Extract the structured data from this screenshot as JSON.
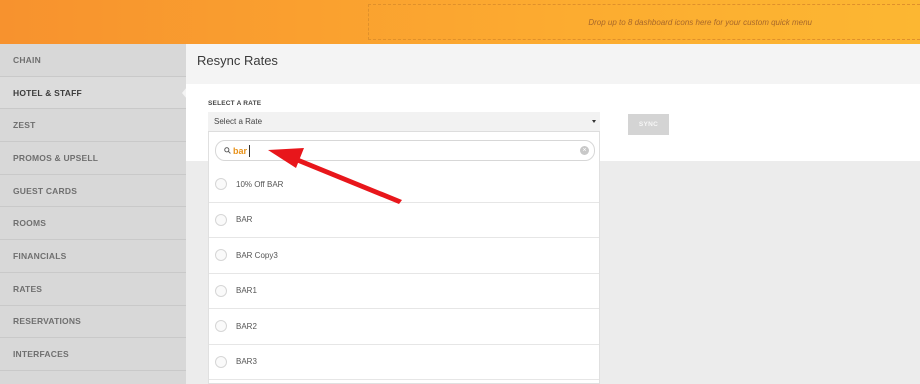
{
  "quick_menu": {
    "hint": "Drop up to 8 dashboard icons here for your custom quick menu"
  },
  "sidebar": {
    "items": [
      {
        "label": "CHAIN"
      },
      {
        "label": "HOTEL & STAFF"
      },
      {
        "label": "ZEST"
      },
      {
        "label": "PROMOS & UPSELL"
      },
      {
        "label": "GUEST CARDS"
      },
      {
        "label": "ROOMS"
      },
      {
        "label": "FINANCIALS"
      },
      {
        "label": "RATES"
      },
      {
        "label": "RESERVATIONS"
      },
      {
        "label": "INTERFACES"
      }
    ]
  },
  "page": {
    "title": "Resync Rates",
    "select_label": "SELECT A RATE",
    "select_value": "Select a Rate",
    "sync_label": "SYNC"
  },
  "dropdown": {
    "search_value": "bar",
    "options": [
      {
        "label": "10% Off BAR"
      },
      {
        "label": "BAR"
      },
      {
        "label": "BAR Copy3"
      },
      {
        "label": "BAR1"
      },
      {
        "label": "BAR2"
      },
      {
        "label": "BAR3"
      }
    ]
  },
  "colors": {
    "brand_orange": "#f7922e",
    "highlight": "#e8921a",
    "arrow_red": "#e8161b"
  },
  "icons": {
    "search": "search-icon",
    "clear": "clear-icon",
    "caret": "chevron-down-icon",
    "annotation": "arrow-annotation"
  }
}
